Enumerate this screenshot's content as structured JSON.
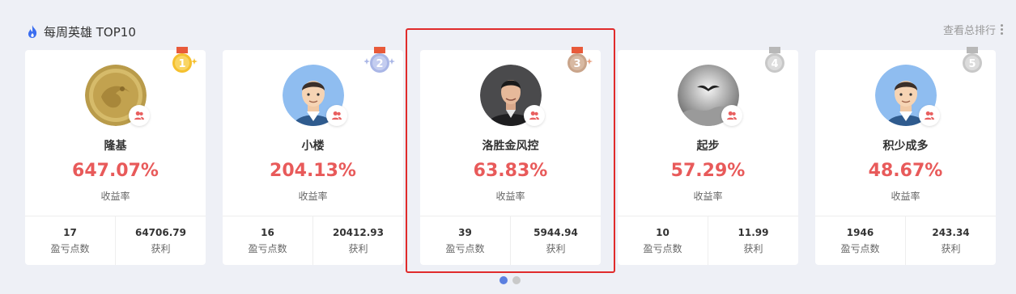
{
  "header": {
    "title": "每周英雄 TOP10",
    "more_label": "查看总排行",
    "accent": "#3a6df0"
  },
  "cards": [
    {
      "rank": "1",
      "name": "隆基",
      "percent": "647.07%",
      "percent_label": "收益率",
      "points": "17",
      "points_label": "盈亏点数",
      "profit": "64706.79",
      "profit_label": "获利",
      "medal_color": "#f5c02e",
      "avatar": "gold-coin"
    },
    {
      "rank": "2",
      "name": "小楼",
      "percent": "204.13%",
      "percent_label": "收益率",
      "points": "16",
      "points_label": "盈亏点数",
      "profit": "20412.93",
      "profit_label": "获利",
      "medal_color": "#a9b6e6",
      "avatar": "default-man"
    },
    {
      "rank": "3",
      "name": "洛胜金风控",
      "percent": "63.83%",
      "percent_label": "收益率",
      "points": "39",
      "points_label": "盈亏点数",
      "profit": "5944.94",
      "profit_label": "获利",
      "medal_color": "#c9a48a",
      "avatar": "photo-man"
    },
    {
      "rank": "4",
      "name": "起步",
      "percent": "57.29%",
      "percent_label": "收益率",
      "points": "10",
      "points_label": "盈亏点数",
      "profit": "11.99",
      "profit_label": "获利",
      "medal_color": "#c8c8c8",
      "avatar": "bird-sky"
    },
    {
      "rank": "5",
      "name": "积少成多",
      "percent": "48.67%",
      "percent_label": "收益率",
      "points": "1946",
      "points_label": "盈亏点数",
      "profit": "243.34",
      "profit_label": "获利",
      "medal_color": "#c8c8c8",
      "avatar": "default-man"
    }
  ],
  "highlight_color": "#e02b2b",
  "pager": {
    "active_color": "#5b7fe0",
    "inactive_color": "#c9c9c9"
  }
}
